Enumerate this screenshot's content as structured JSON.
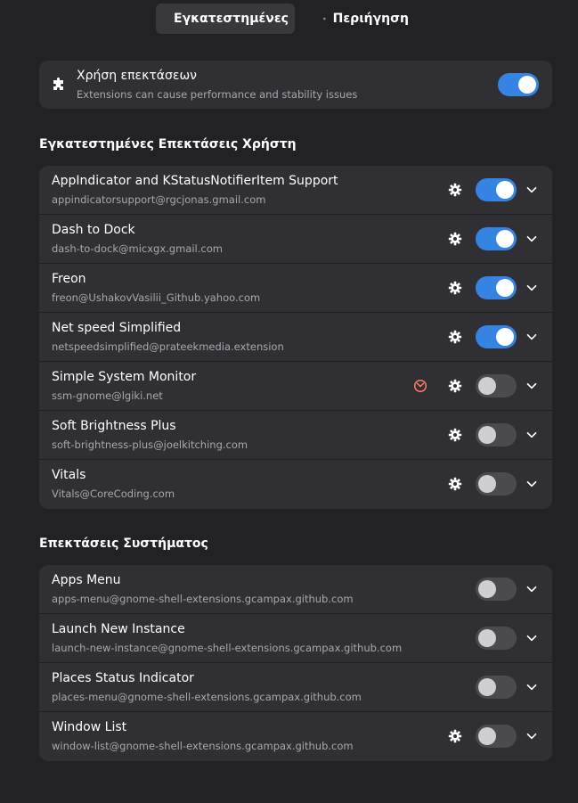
{
  "tabs": [
    {
      "label": "Εγκατεστημένες",
      "icon": "puzzle-icon",
      "active": true
    },
    {
      "label": "Περιήγηση",
      "icon": "globe-icon",
      "active": false
    }
  ],
  "master": {
    "title": "Χρήση επεκτάσεων",
    "subtitle": "Extensions can cause performance and stability issues",
    "enabled": true
  },
  "user_section": {
    "title": "Εγκατεστημένες Επεκτάσεις Χρήστη",
    "items": [
      {
        "title": "AppIndicator and KStatusNotifierItem Support",
        "uuid": "appindicatorsupport@rgcjonas.gmail.com",
        "settings": true,
        "enabled": true,
        "outdated": false
      },
      {
        "title": "Dash to Dock",
        "uuid": "dash-to-dock@micxgx.gmail.com",
        "settings": true,
        "enabled": true,
        "outdated": false
      },
      {
        "title": "Freon",
        "uuid": "freon@UshakovVasilii_Github.yahoo.com",
        "settings": true,
        "enabled": true,
        "outdated": false
      },
      {
        "title": "Net speed Simplified",
        "uuid": "netspeedsimplified@prateekmedia.extension",
        "settings": true,
        "enabled": true,
        "outdated": false
      },
      {
        "title": "Simple System Monitor",
        "uuid": "ssm-gnome@lgiki.net",
        "settings": true,
        "enabled": false,
        "outdated": true
      },
      {
        "title": "Soft Brightness Plus",
        "uuid": "soft-brightness-plus@joelkitching.com",
        "settings": true,
        "enabled": false,
        "outdated": false
      },
      {
        "title": "Vitals",
        "uuid": "Vitals@CoreCoding.com",
        "settings": true,
        "enabled": false,
        "outdated": false
      }
    ]
  },
  "system_section": {
    "title": "Επεκτάσεις Συστήματος",
    "items": [
      {
        "title": "Apps Menu",
        "uuid": "apps-menu@gnome-shell-extensions.gcampax.github.com",
        "settings": false,
        "enabled": false,
        "outdated": false
      },
      {
        "title": "Launch New Instance",
        "uuid": "launch-new-instance@gnome-shell-extensions.gcampax.github.com",
        "settings": false,
        "enabled": false,
        "outdated": false
      },
      {
        "title": "Places Status Indicator",
        "uuid": "places-menu@gnome-shell-extensions.gcampax.github.com",
        "settings": false,
        "enabled": false,
        "outdated": false
      },
      {
        "title": "Window List",
        "uuid": "window-list@gnome-shell-extensions.gcampax.github.com",
        "settings": true,
        "enabled": false,
        "outdated": false
      }
    ]
  },
  "colors": {
    "accent": "#3584e4",
    "card": "#303034",
    "background": "#222226",
    "warning_icon": "#ff7b63"
  }
}
